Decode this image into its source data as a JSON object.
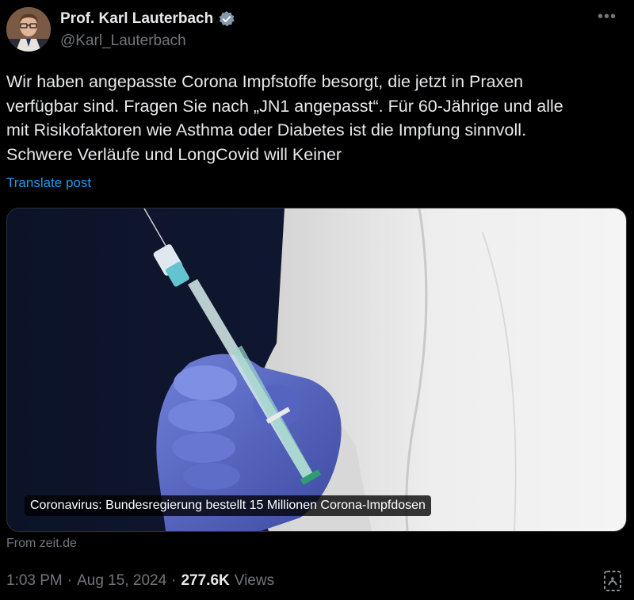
{
  "author": {
    "display_name": "Prof. Karl Lauterbach",
    "handle": "@Karl_Lauterbach",
    "verified_icon": "verified-badge-icon",
    "more_icon": "more-options-icon"
  },
  "tweet": {
    "text": "Wir haben angepasste Corona Impfstoffe besorgt, die jetzt in Praxen\nverfügbar sind. Fragen Sie nach „JN1 angepasst“. Für 60-Jährige und alle\nmit Risikofaktoren wie Asthma oder Diabetes ist die Impfung sinnvoll.\nSchwere Verläufe und LongCovid will Keiner",
    "translate_label": "Translate post"
  },
  "link_card": {
    "caption": "Coronavirus: Bundesregierung bestellt 15 Millionen Corona-Impfdosen",
    "source": "From zeit.de"
  },
  "meta": {
    "time": "1:03 PM",
    "sep1": "·",
    "date": "Aug 15, 2024",
    "sep2": "·",
    "views_count": "277.6K",
    "views_label": "Views",
    "analytics_icon": "post-analytics-icon"
  },
  "colors": {
    "background": "#000000",
    "text": "#e7e9ea",
    "muted": "#71767b",
    "link": "#1d9bf0"
  }
}
